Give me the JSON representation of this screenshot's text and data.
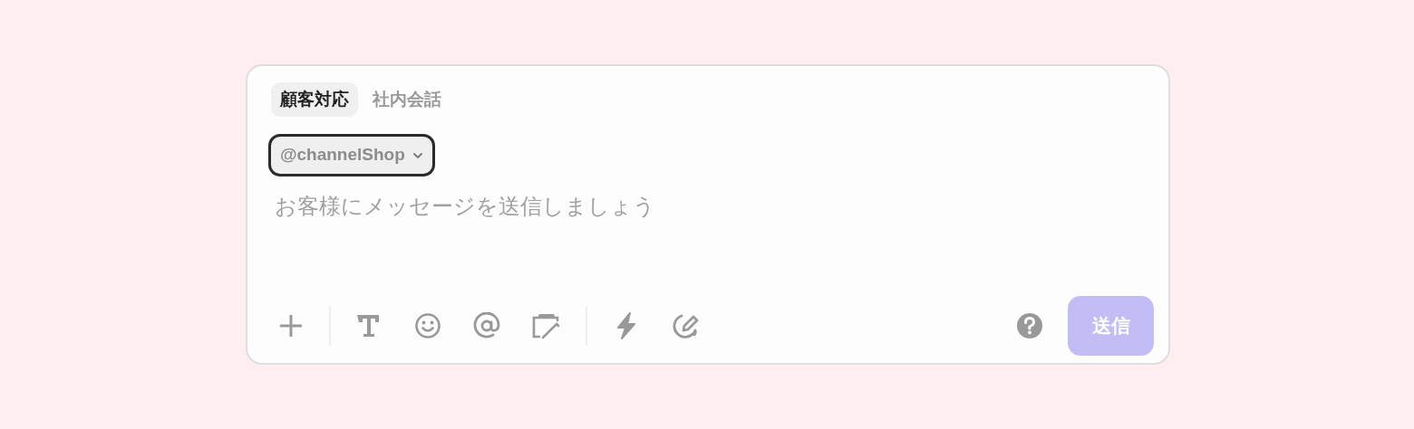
{
  "tabs": [
    {
      "label": "顧客対応",
      "selected": true
    },
    {
      "label": "社内会話",
      "selected": false
    }
  ],
  "channel_selector": {
    "value": "@channelShop",
    "focused": true
  },
  "message": {
    "placeholder": "お客様にメッセージを送信しましょう"
  },
  "send_button": {
    "label": "送信",
    "disabled": true
  }
}
